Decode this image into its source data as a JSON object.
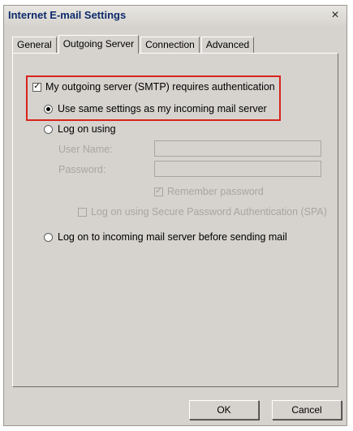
{
  "window": {
    "title": "Internet E-mail Settings",
    "close_glyph": "×"
  },
  "tabs": [
    {
      "label": "General",
      "active": false
    },
    {
      "label": "Outgoing Server",
      "active": true
    },
    {
      "label": "Connection",
      "active": false
    },
    {
      "label": "Advanced",
      "active": false
    }
  ],
  "outgoing": {
    "requires_auth": {
      "label": "My outgoing server (SMTP) requires authentication",
      "checked": true
    },
    "same_settings": {
      "label": "Use same settings as my incoming mail server",
      "selected": true
    },
    "log_on_using": {
      "label": "Log on using",
      "selected": false
    },
    "user_name_label": "User Name:",
    "user_name_value": "",
    "password_label": "Password:",
    "password_value": "",
    "remember_password": {
      "label": "Remember password",
      "checked": true
    },
    "spa": {
      "label": "Log on using Secure Password Authentication (SPA)",
      "checked": false
    },
    "log_on_incoming": {
      "label": "Log on to incoming mail server before sending mail",
      "selected": false
    }
  },
  "buttons": {
    "ok": "OK",
    "cancel": "Cancel"
  },
  "colors": {
    "highlight": "#d8231c",
    "dialog_bg": "#d6d3ce",
    "title_text": "#0d2a6b"
  }
}
